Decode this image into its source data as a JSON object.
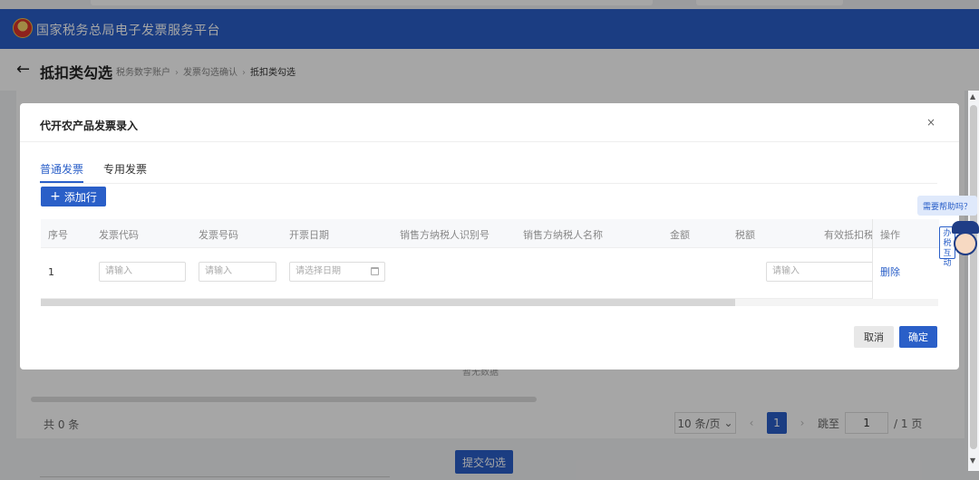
{
  "header": {
    "title": "国家税务总局电子发票服务平台",
    "logo": "tax-emblem-icon"
  },
  "crumbbar": {
    "page_title": "抵扣类勾选",
    "crumbs": [
      "税务数字账户",
      "发票勾选确认",
      "抵扣类勾选"
    ]
  },
  "background": {
    "empty_text": "暂无数据",
    "total": "共 0 条",
    "page_size": "10 条/页",
    "current_page": "1",
    "jump_label": "跳至",
    "jump_value": "1",
    "total_pages": "/ 1 页",
    "submit_label": "提交勾选"
  },
  "dialog": {
    "title": "代开农产品发票录入",
    "close": "×",
    "tabs": [
      {
        "label": "普通发票",
        "active": true
      },
      {
        "label": "专用发票",
        "active": false
      }
    ],
    "add_row_label": "添加行",
    "columns": [
      "序号",
      "发票代码",
      "发票号码",
      "开票日期",
      "销售方纳税人识别号",
      "销售方纳税人名称",
      "金额",
      "税额",
      "有效抵扣税额",
      "操作"
    ],
    "row": {
      "index": "1",
      "code_placeholder": "请输入",
      "number_placeholder": "请输入",
      "date_placeholder": "请选择日期",
      "deduct_placeholder": "请输入",
      "delete_label": "删除"
    },
    "cancel_label": "取消",
    "ok_label": "确定"
  },
  "help": {
    "bubble": "需要帮助吗？",
    "tag": "办税互动"
  },
  "colors": {
    "primary": "#2a5fc8",
    "header_bg": "#2a5fc8"
  }
}
